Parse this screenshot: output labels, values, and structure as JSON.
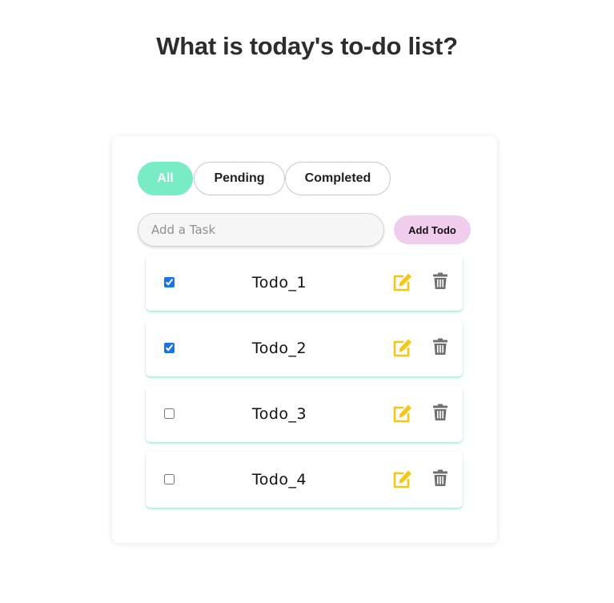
{
  "header": {
    "title": "What is today's to-do list?"
  },
  "filters": {
    "all_label": "All",
    "pending_label": "Pending",
    "completed_label": "Completed",
    "active": "All"
  },
  "new_task": {
    "placeholder": "Add a Task",
    "value": "",
    "add_label": "Add Todo"
  },
  "todos": [
    {
      "text": "Todo_1",
      "checked": true
    },
    {
      "text": "Todo_2",
      "checked": true
    },
    {
      "text": "Todo_3",
      "checked": false
    },
    {
      "text": "Todo_4",
      "checked": false
    }
  ],
  "icons": {
    "edit": "edit-icon",
    "delete": "trash-icon"
  },
  "colors": {
    "active_filter": "#78ecc4",
    "add_button": "#f0cdec",
    "edit_icon": "#f5c518",
    "delete_icon": "#707070",
    "checkbox": "#1a73e8"
  }
}
